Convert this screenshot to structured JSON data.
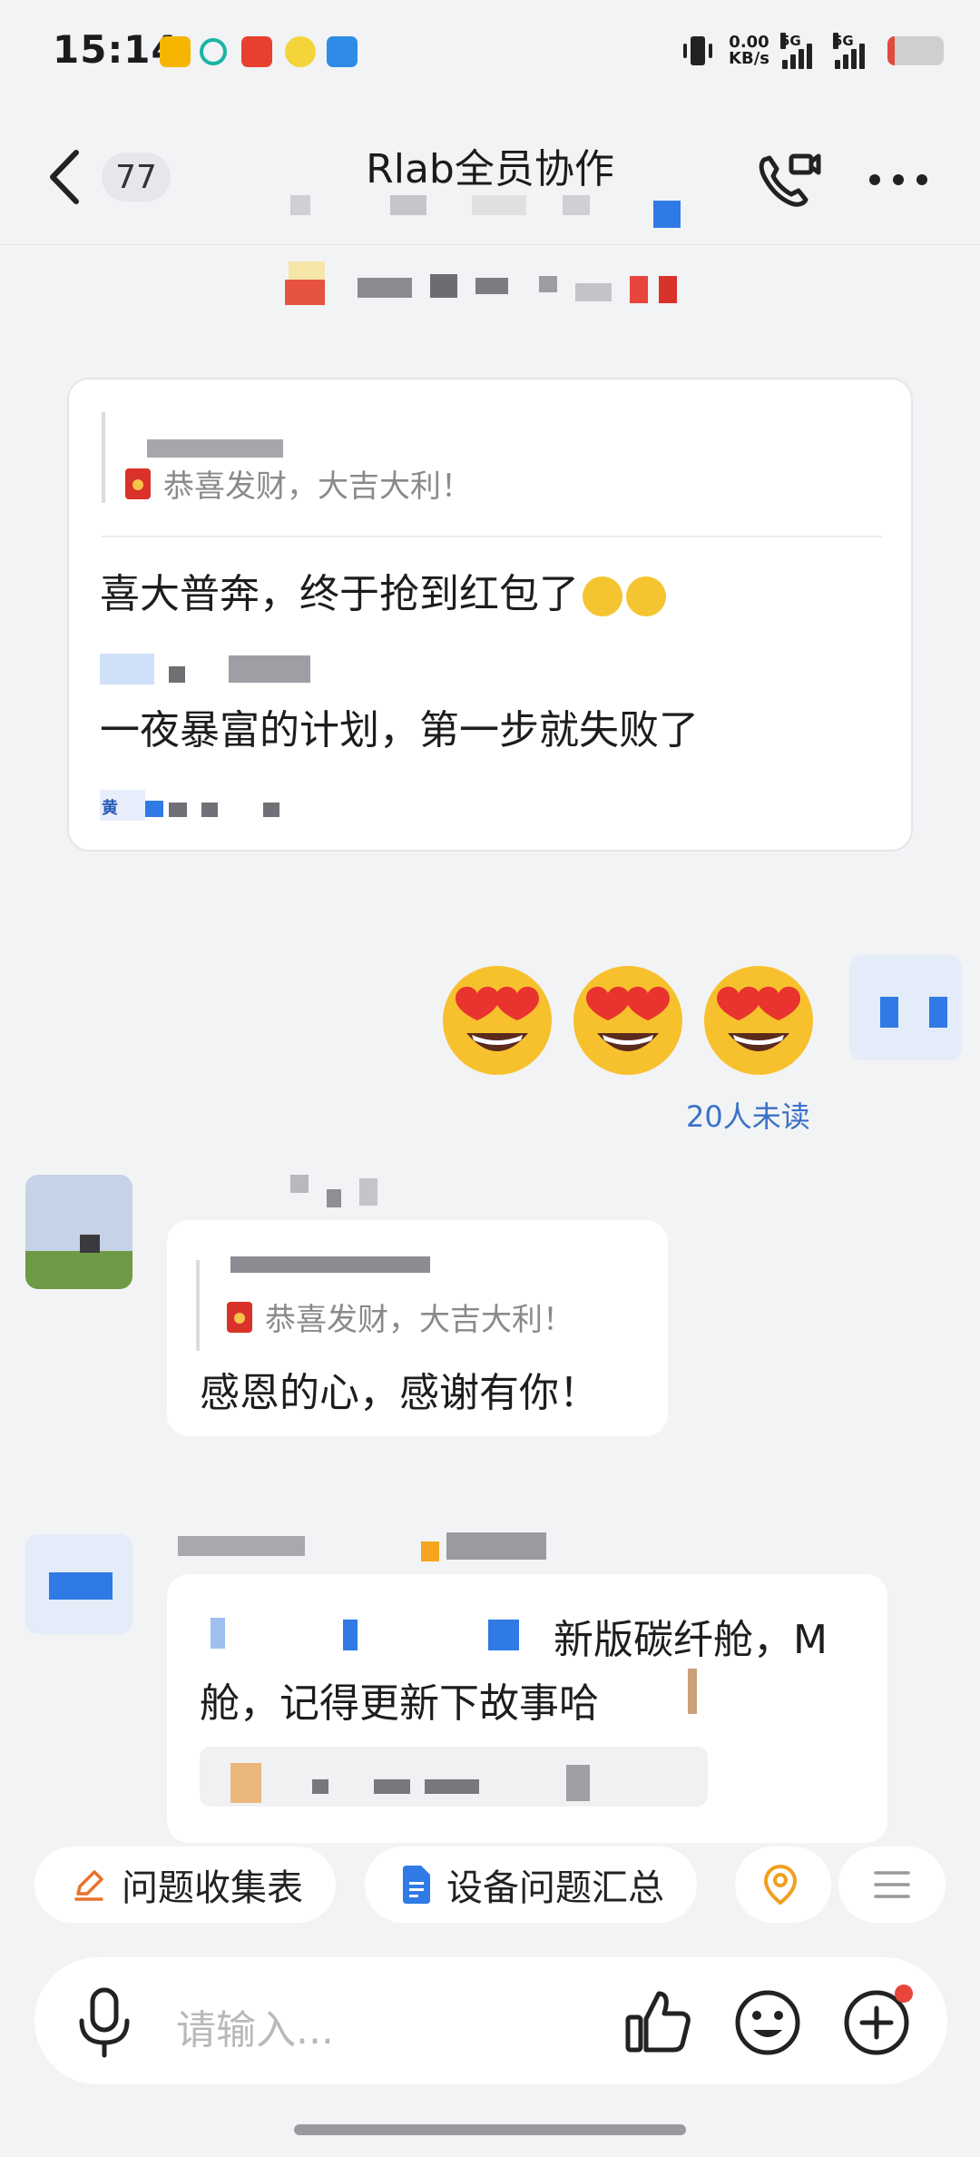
{
  "status_bar": {
    "time": "15:14",
    "net_speed_value": "0.00",
    "net_speed_unit": "KB/s",
    "signal_1": "5G",
    "signal_2": "5G"
  },
  "header": {
    "unread_count": "77",
    "title": "Rlab全员协作"
  },
  "messages": {
    "card1": {
      "quote": "恭喜发财，大吉大利！",
      "line1": "喜大普奔，终于抢到红包了",
      "line2": "一夜暴富的计划，第一步就失败了",
      "tag": "黄"
    },
    "self_reply": {
      "read_status": "20人未读"
    },
    "card2": {
      "quote": "恭喜发财，大吉大利！",
      "text": "感恩的心，感谢有你！"
    },
    "card3": {
      "line1": "新版碳纤舱，M",
      "line2": "舱，记得更新下故事哈"
    }
  },
  "quick_actions": [
    {
      "label": "问题收集表"
    },
    {
      "label": "设备问题汇总"
    }
  ],
  "input": {
    "placeholder": "请输入..."
  },
  "colors": {
    "accent_blue": "#3a72c8",
    "red_packet": "#d9322a",
    "badge_red": "#e8453c",
    "background": "#f2f3f5"
  }
}
